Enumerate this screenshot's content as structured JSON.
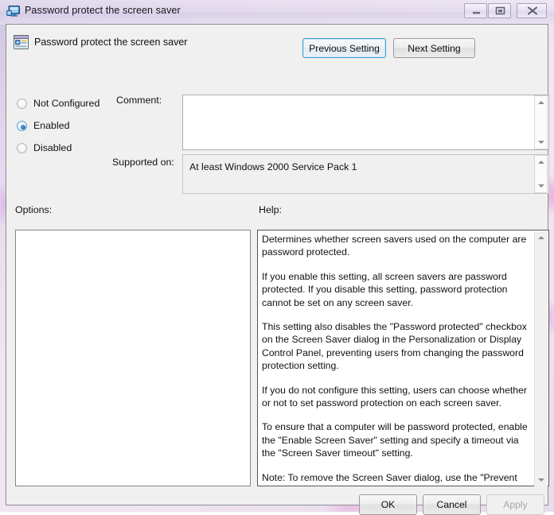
{
  "window": {
    "title": "Password protect the screen saver",
    "title_icon": "computer-monitor-icon",
    "controls": {
      "minimize_label": "Minimize",
      "maximize_label": "Restore",
      "close_label": "Close"
    }
  },
  "setting": {
    "header_icon": "policy-setting-icon",
    "header_title": "Password protect the screen saver"
  },
  "nav": {
    "previous_label": "Previous Setting",
    "next_label": "Next Setting"
  },
  "state_options": [
    {
      "label": "Not Configured",
      "selected": false
    },
    {
      "label": "Enabled",
      "selected": true
    },
    {
      "label": "Disabled",
      "selected": false
    }
  ],
  "fields": {
    "comment_label": "Comment:",
    "comment_value": "",
    "supported_label": "Supported on:",
    "supported_value": "At least Windows 2000 Service Pack 1"
  },
  "panels": {
    "options_label": "Options:",
    "options_value": "",
    "help_label": "Help:",
    "help_paragraphs": [
      "Determines whether screen savers used on the computer are password protected.",
      "If you enable this setting, all screen savers are password protected. If you disable this setting, password protection cannot be set on any screen saver.",
      "This setting also disables the \"Password protected\" checkbox on the Screen Saver dialog in the Personalization or Display Control Panel, preventing users from changing the password protection setting.",
      "If you do not configure this setting, users can choose whether or not to set password protection on each screen saver.",
      "To ensure that a computer will be password protected, enable the \"Enable Screen Saver\" setting and specify a timeout via the \"Screen Saver timeout\" setting.",
      "Note: To remove the Screen Saver dialog, use the \"Prevent changing Screen Saver\" setting."
    ]
  },
  "footer": {
    "ok_label": "OK",
    "cancel_label": "Cancel",
    "apply_label": "Apply",
    "apply_enabled": false
  },
  "colors": {
    "accent_focus": "#3c99d4",
    "dialog_face": "#f0f0f0",
    "text": "#111111",
    "disabled_text": "#a6a6a6"
  }
}
